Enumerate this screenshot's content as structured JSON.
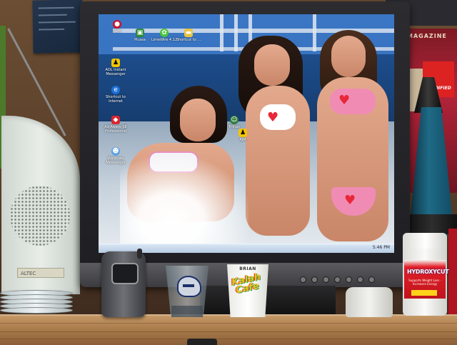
{
  "photo": {
    "monitor": {
      "brand_plate": "",
      "desktop_icons": [
        {
          "label": "Nero",
          "icon": "disc-icon",
          "color": "#c8102e"
        },
        {
          "label": "Picasa",
          "icon": "photo-icon",
          "color": "#2b8a3e"
        },
        {
          "label": "LimeWire 4.12",
          "icon": "lime-icon",
          "color": "#49c43a"
        },
        {
          "label": "Shortcut to ...",
          "icon": "folder-icon",
          "color": "#e8c442"
        },
        {
          "label": "AOL Instant Messenger",
          "icon": "aim-icon",
          "color": "#f2c300"
        },
        {
          "label": "Shortcut to Internet",
          "icon": "ie-icon",
          "color": "#1f6fd6"
        },
        {
          "label": "Ad-Aware SE Professional",
          "icon": "adaware-icon",
          "color": "#d8262e"
        },
        {
          "label": "Windows Messenger",
          "icon": "messenger-icon",
          "color": "#5aa0e0"
        },
        {
          "label": "Trillian",
          "icon": "trillian-icon",
          "color": "#2f7a3a"
        },
        {
          "label": "AIM",
          "icon": "aim-icon",
          "color": "#f2c300"
        }
      ],
      "taskbar_clock": "5:46 PM"
    },
    "cup": {
      "name_text": "BRIAN",
      "art_text": "Kalah Cafe"
    },
    "supplement_bottle": {
      "brand_text": "HYDROXYCUT",
      "sub_text": "Supports Weight Loss · Increases Energy"
    },
    "speaker": {
      "badge_text": "ALTEC"
    },
    "magazine": {
      "title_text": "MAGAZINE",
      "badge_text": "MODIFIED"
    },
    "colors": {
      "wall": "#5a3f2a",
      "shelf": "#b0824f",
      "bezel": "#232327",
      "screen_sky": "#3771bd"
    }
  }
}
